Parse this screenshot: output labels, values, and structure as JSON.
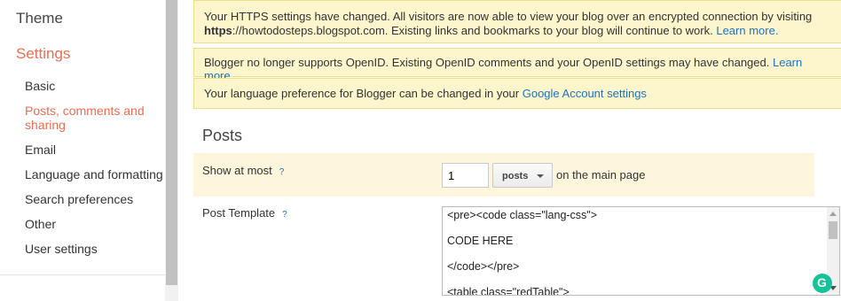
{
  "sidebar": {
    "theme": "Theme",
    "settings": "Settings",
    "items": [
      {
        "label": "Basic"
      },
      {
        "label": "Posts, comments and sharing"
      },
      {
        "label": "Email"
      },
      {
        "label": "Language and formatting"
      },
      {
        "label": "Search preferences"
      },
      {
        "label": "Other"
      },
      {
        "label": "User settings"
      }
    ]
  },
  "notices": {
    "https": {
      "text1": "Your HTTPS settings have changed. All visitors are now able to view your blog over an encrypted connection by visiting",
      "bold": "https",
      "text2": "://howtodosteps.blogspot.com. Existing links and bookmarks to your blog will continue to work.",
      "link": "Learn more."
    },
    "openid": {
      "text": "Blogger no longer supports OpenID. Existing OpenID comments and your OpenID settings may have changed.",
      "link": "Learn more."
    },
    "language": {
      "text": "Your language preference for Blogger can be changed in your",
      "link": "Google Account settings"
    }
  },
  "posts": {
    "section_title": "Posts",
    "show_at_most": {
      "label": "Show at most",
      "help": "?",
      "value": "1",
      "unit": "posts",
      "suffix": "on the main page"
    },
    "post_template": {
      "label": "Post Template",
      "help": "?",
      "lines": [
        "<pre><code class=\"lang-css\">",
        "CODE HERE",
        "</code></pre>",
        "<table class=\"redTable\">"
      ]
    }
  },
  "colors": {
    "accent": "#f06c4f",
    "link": "#1a73c8",
    "notice_bg": "#fdf5cc"
  }
}
